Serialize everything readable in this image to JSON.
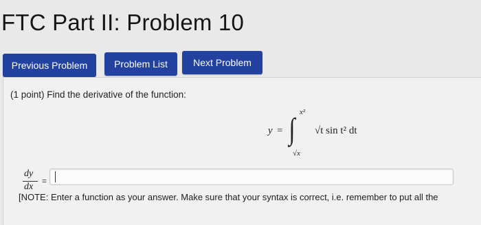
{
  "page_title": "FTC Part II: Problem 10",
  "nav": {
    "previous_label": "Previous Problem",
    "list_label": "Problem List",
    "next_label": "Next Problem"
  },
  "problem": {
    "intro": "(1 point) Find the derivative of the function:",
    "equation": {
      "lhs": "y",
      "equals": "=",
      "integral_sign": "∫",
      "upper_limit": "x²",
      "lower_limit": "√x",
      "integrand": "√t sin t² dt"
    },
    "answer": {
      "label_numerator": "dy",
      "label_denominator": "dx",
      "equals": "=",
      "value": "",
      "placeholder": ""
    },
    "note": "[NOTE: Enter a function as your answer. Make sure that your syntax is correct, i.e. remember to put all the"
  },
  "colors": {
    "button_bg": "#23419f",
    "button_text": "#ffffff",
    "page_bg": "#e9e9e9",
    "panel_bg": "#f1f1f1"
  }
}
